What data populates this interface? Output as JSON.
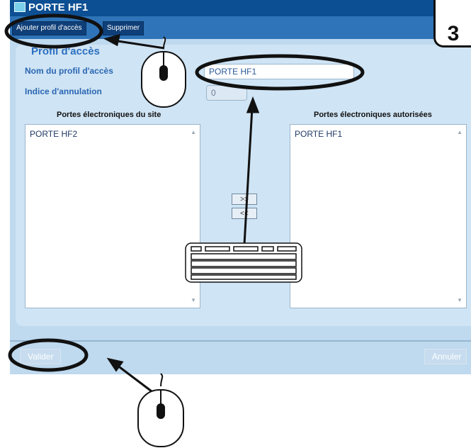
{
  "window": {
    "title": "PORTE HF1"
  },
  "toolbar": {
    "add_profile_label": "Ajouter profil d'accès",
    "delete_label": "Supprimer"
  },
  "form": {
    "section_title": "Profil d'accès",
    "profile_name_label": "Nom du profil d'accès",
    "profile_name_value": "PORTE HF1",
    "cancel_index_label": "Indice d'annulation",
    "cancel_index_value": "0"
  },
  "lists": {
    "site_title": "Portes électroniques du site",
    "site_items": [
      "PORTE HF2"
    ],
    "authorized_title": "Portes électroniques autorisées",
    "authorized_items": [
      "PORTE HF1"
    ],
    "add_button": ">>",
    "remove_button": "<<"
  },
  "footer": {
    "validate_label": "Valider",
    "cancel_label": "Annuler"
  },
  "annotations": {
    "step_number": "3"
  },
  "colors": {
    "title_bar": "#0c4f93",
    "toolbar": "#2f74b8",
    "panel": "#bfd9ee",
    "label_blue": "#2a66b3"
  }
}
